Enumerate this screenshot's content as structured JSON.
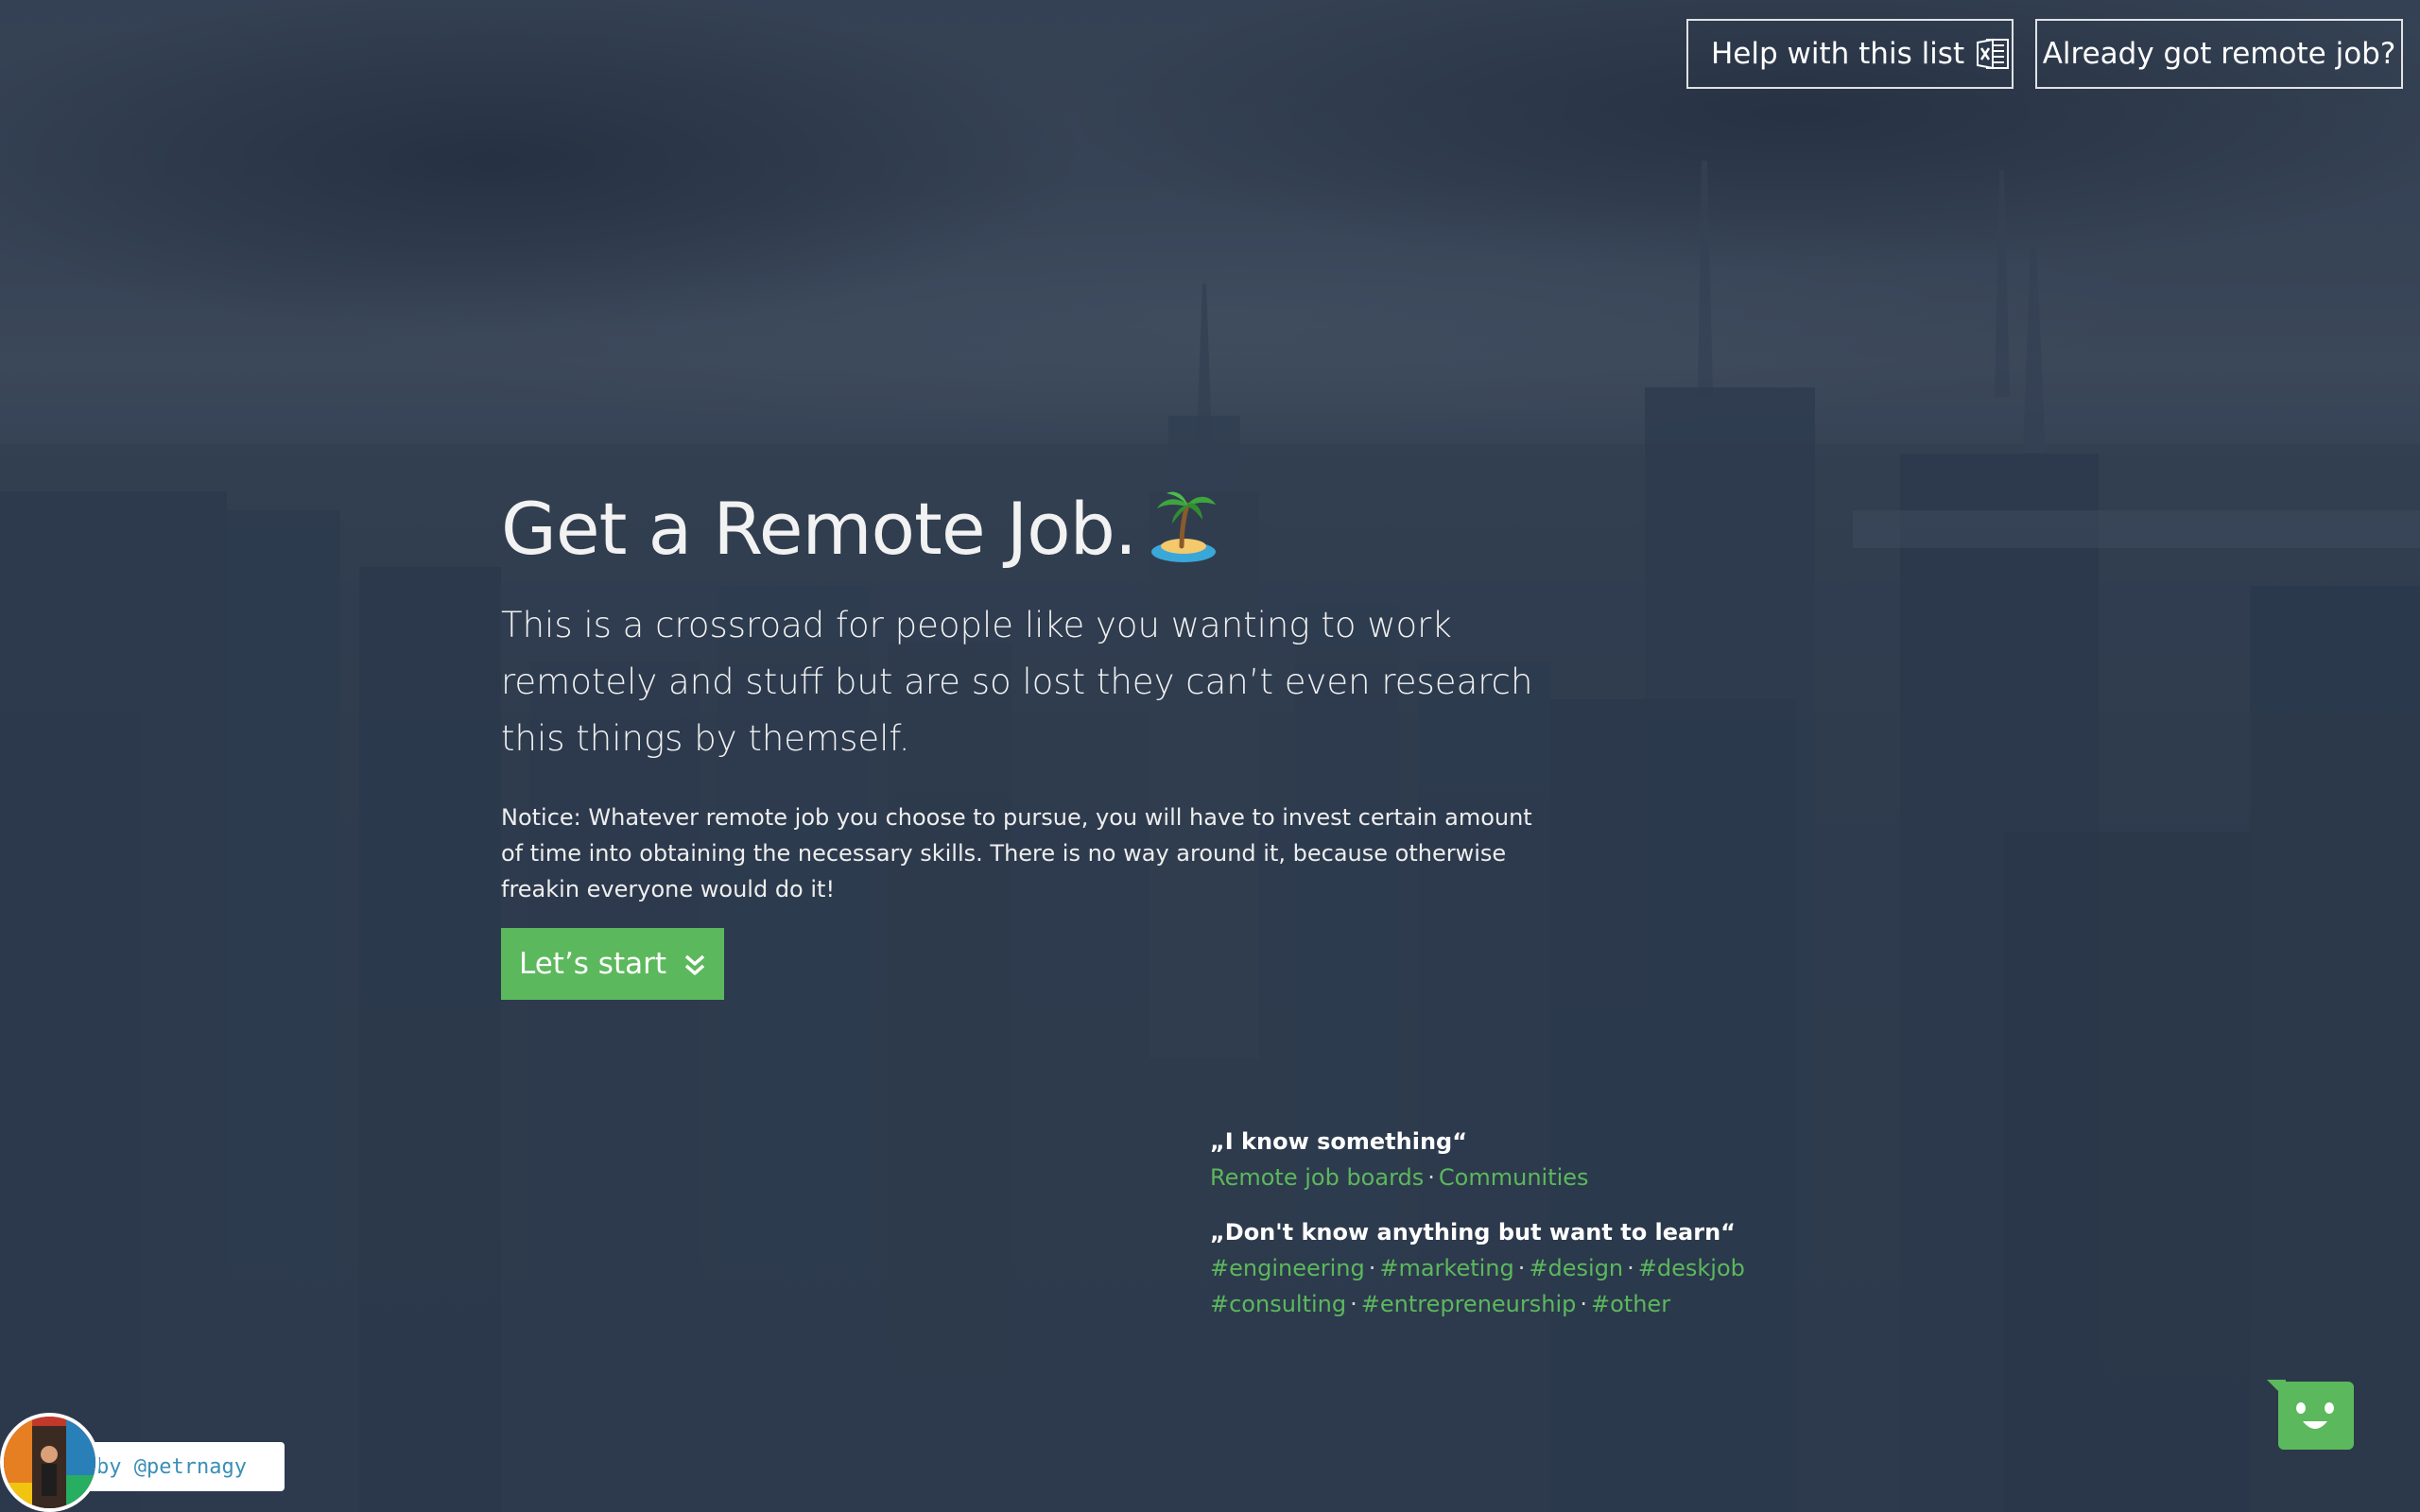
{
  "header": {
    "help_button": {
      "label": "Help with this list",
      "icon": "excel-spreadsheet-icon"
    },
    "remote_button": {
      "label": "Already got remote job?"
    }
  },
  "hero": {
    "title": "Get a Remote Job.",
    "title_icon": "palm-tree-island-icon",
    "lead": "This is a crossroad for people like you wanting to work remotely and stuff but are so lost they can’t even research this things by themself.",
    "notice": "Notice: Whatever remote job you choose to pursue, you will have to invest certain amount of time into obtaining the necessary skills. There is no way around it, because otherwise freakin everyone would do it!",
    "start_button": {
      "label": "Let’s start",
      "icon": "double-chevron-down-icon"
    }
  },
  "paths": {
    "know_something": {
      "title": "„I know something“",
      "links": [
        "Remote job boards",
        "Communities"
      ]
    },
    "want_to_learn": {
      "title": "„Don't know anything but want to learn“",
      "links": [
        "#engineering",
        "#marketing",
        "#design",
        "#deskjob",
        "#consulting",
        "#entrepreneurship",
        "#other"
      ],
      "separator": "·"
    }
  },
  "author": {
    "label": "by @petrnagy",
    "avatar_icon": "author-avatar"
  },
  "chat": {
    "icon": "smiley-chat-icon"
  },
  "colors": {
    "accent_green": "#5cb85c",
    "background_navy": "#2c3a4c",
    "author_link": "#3a8fb7"
  }
}
